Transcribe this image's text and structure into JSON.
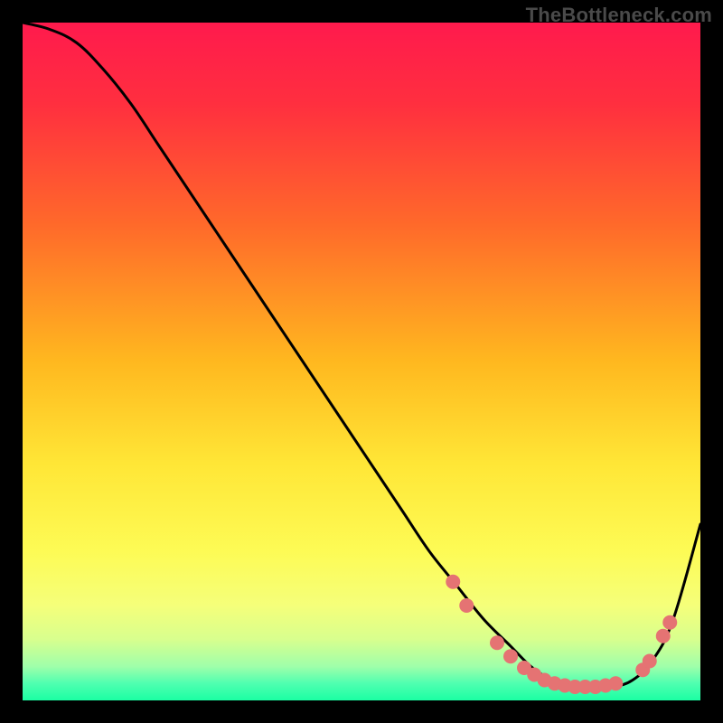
{
  "watermark": "TheBottleneck.com",
  "colors": {
    "frame": "#000000",
    "watermark": "#4a4a4a",
    "curve": "#000000",
    "marker_fill": "#e57373",
    "marker_stroke": "#c94f4f",
    "gradient_stops": [
      {
        "offset": 0.0,
        "color": "#ff1a4d"
      },
      {
        "offset": 0.12,
        "color": "#ff2f3f"
      },
      {
        "offset": 0.3,
        "color": "#ff6a2a"
      },
      {
        "offset": 0.5,
        "color": "#ffb81f"
      },
      {
        "offset": 0.65,
        "color": "#ffe636"
      },
      {
        "offset": 0.78,
        "color": "#fdfb55"
      },
      {
        "offset": 0.86,
        "color": "#f5ff7a"
      },
      {
        "offset": 0.91,
        "color": "#d8ff8e"
      },
      {
        "offset": 0.95,
        "color": "#9fffaa"
      },
      {
        "offset": 0.975,
        "color": "#4fffb0"
      },
      {
        "offset": 1.0,
        "color": "#1bffa3"
      }
    ]
  },
  "chart_data": {
    "type": "line",
    "title": "",
    "xlabel": "",
    "ylabel": "",
    "xlim": [
      0,
      100
    ],
    "ylim": [
      0,
      100
    ],
    "grid": false,
    "legend": false,
    "series": [
      {
        "name": "bottleneck-curve",
        "x": [
          0,
          4,
          8,
          12,
          16,
          20,
          24,
          28,
          32,
          36,
          40,
          44,
          48,
          52,
          56,
          60,
          64,
          68,
          72,
          75,
          78,
          81,
          84,
          87,
          90,
          93,
          96,
          100
        ],
        "y": [
          100,
          99,
          97,
          93,
          88,
          82,
          76,
          70,
          64,
          58,
          52,
          46,
          40,
          34,
          28,
          22,
          17,
          12,
          8,
          5,
          3,
          2,
          2,
          2,
          3,
          6,
          12,
          26
        ]
      }
    ],
    "markers": [
      {
        "x": 63.5,
        "y": 17.5
      },
      {
        "x": 65.5,
        "y": 14.0
      },
      {
        "x": 70.0,
        "y": 8.5
      },
      {
        "x": 72.0,
        "y": 6.5
      },
      {
        "x": 74.0,
        "y": 4.8
      },
      {
        "x": 75.5,
        "y": 3.8
      },
      {
        "x": 77.0,
        "y": 3.0
      },
      {
        "x": 78.5,
        "y": 2.5
      },
      {
        "x": 80.0,
        "y": 2.2
      },
      {
        "x": 81.5,
        "y": 2.0
      },
      {
        "x": 83.0,
        "y": 2.0
      },
      {
        "x": 84.5,
        "y": 2.0
      },
      {
        "x": 86.0,
        "y": 2.2
      },
      {
        "x": 87.5,
        "y": 2.5
      },
      {
        "x": 91.5,
        "y": 4.5
      },
      {
        "x": 92.5,
        "y": 5.8
      },
      {
        "x": 94.5,
        "y": 9.5
      },
      {
        "x": 95.5,
        "y": 11.5
      }
    ]
  }
}
